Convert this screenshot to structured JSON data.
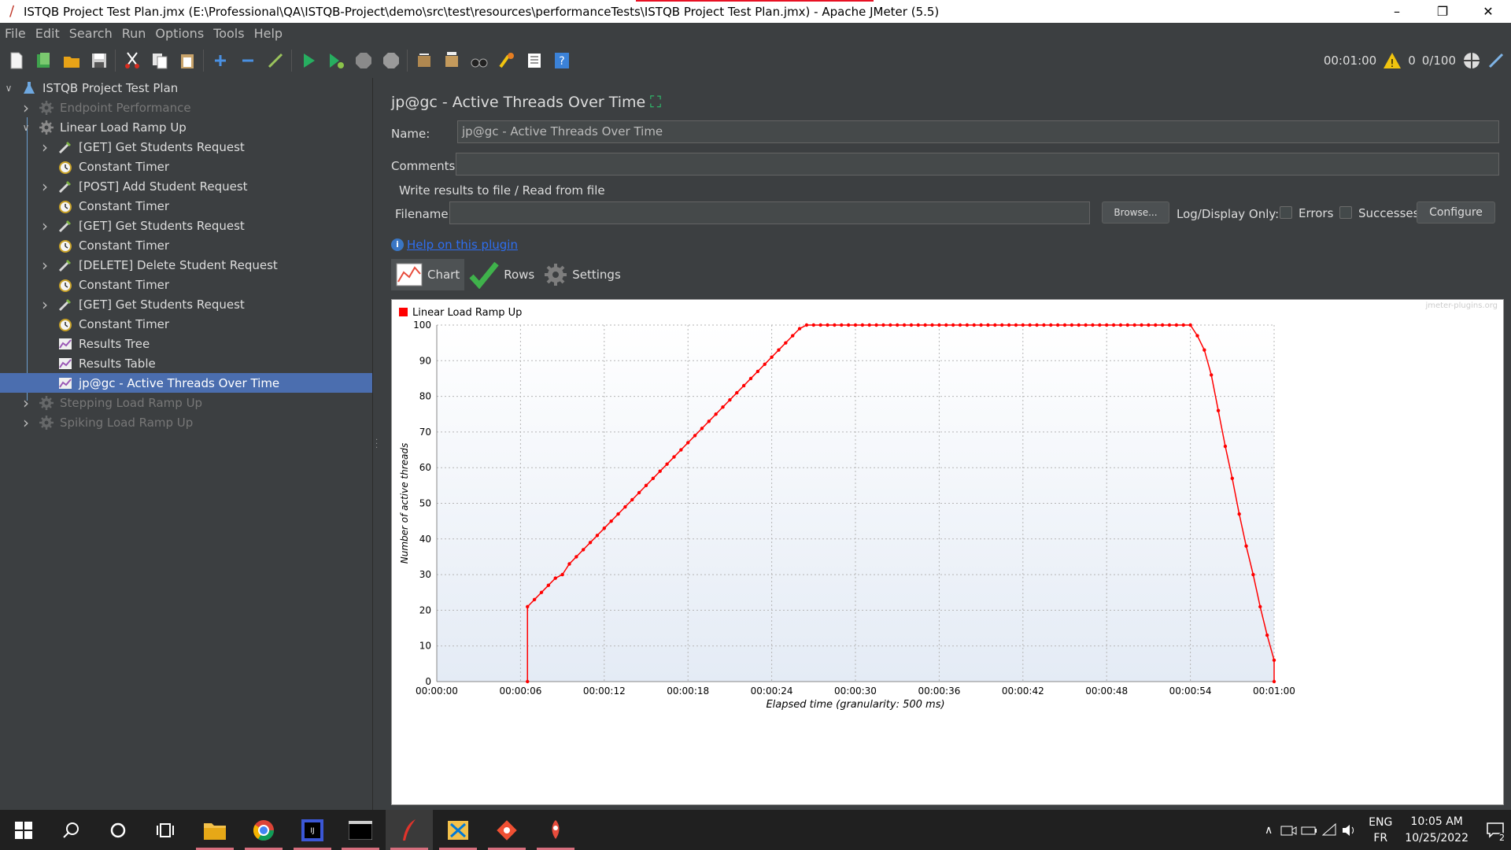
{
  "window": {
    "title": "ISTQB Project Test Plan.jmx (E:\\Professional\\QA\\ISTQB-Project\\demo\\src\\test\\resources\\performanceTests\\ISTQB Project Test Plan.jmx) - Apache JMeter (5.5)",
    "minimize": "–",
    "maximize": "❐",
    "close": "✕"
  },
  "menu": [
    "File",
    "Edit",
    "Search",
    "Run",
    "Options",
    "Tools",
    "Help"
  ],
  "toolbar": {
    "elapsed": "00:01:00",
    "warnings": "0",
    "threads": "0/100"
  },
  "tree": {
    "root": "ISTQB Project Test Plan",
    "items": [
      {
        "label": "Endpoint Performance",
        "icon": "gear-icon",
        "disabled": true
      },
      {
        "label": "Linear Load Ramp Up",
        "icon": "gear-icon",
        "disabled": false
      },
      {
        "label": "[GET] Get Students Request",
        "icon": "pipette-icon",
        "disabled": false
      },
      {
        "label": "Constant Timer",
        "icon": "timer-icon",
        "disabled": false
      },
      {
        "label": "[POST] Add Student Request",
        "icon": "pipette-icon",
        "disabled": false
      },
      {
        "label": "Constant Timer",
        "icon": "timer-icon",
        "disabled": false
      },
      {
        "label": "[GET] Get Students Request",
        "icon": "pipette-icon",
        "disabled": false
      },
      {
        "label": "Constant Timer",
        "icon": "timer-icon",
        "disabled": false
      },
      {
        "label": "[DELETE] Delete Student Request",
        "icon": "pipette-icon",
        "disabled": false
      },
      {
        "label": "Constant Timer",
        "icon": "timer-icon",
        "disabled": false
      },
      {
        "label": "[GET] Get Students Request",
        "icon": "pipette-icon",
        "disabled": false
      },
      {
        "label": "Constant Timer",
        "icon": "timer-icon",
        "disabled": false
      },
      {
        "label": "Results Tree",
        "icon": "listener-icon",
        "disabled": false
      },
      {
        "label": "Results Table",
        "icon": "listener-icon",
        "disabled": false
      },
      {
        "label": "jp@gc - Active Threads Over Time",
        "icon": "listener-icon",
        "disabled": false
      },
      {
        "label": "Stepping Load Ramp Up",
        "icon": "gear-icon",
        "disabled": true
      },
      {
        "label": "Spiking Load Ramp Up",
        "icon": "gear-icon",
        "disabled": true
      }
    ]
  },
  "panel": {
    "title": "jp@gc - Active Threads Over Time",
    "name_label": "Name:",
    "name_value": "jp@gc - Active Threads Over Time",
    "comments_label": "Comments:",
    "comments_value": "",
    "file_section": "Write results to file / Read from file",
    "filename_label": "Filename",
    "filename_value": "",
    "browse": "Browse...",
    "log_display": "Log/Display Only:",
    "errors": "Errors",
    "successes": "Successes",
    "configure": "Configure",
    "help_link": "Help on this plugin",
    "tabs": [
      "Chart",
      "Rows",
      "Settings"
    ]
  },
  "chart_data": {
    "type": "line",
    "watermark": "jmeter-plugins.org",
    "xlabel": "Elapsed time (granularity: 500 ms)",
    "ylabel": "Number of active threads",
    "xticks": [
      "00:00:00",
      "00:00:06",
      "00:00:12",
      "00:00:18",
      "00:00:24",
      "00:00:30",
      "00:00:36",
      "00:00:42",
      "00:00:48",
      "00:00:54",
      "00:01:00"
    ],
    "yticks": [
      0,
      10,
      20,
      30,
      40,
      50,
      60,
      70,
      80,
      90,
      100
    ],
    "xlim": [
      0,
      60
    ],
    "ylim": [
      0,
      100
    ],
    "grid": true,
    "legend_position": "top-left",
    "series": [
      {
        "name": "Linear Load Ramp Up",
        "color": "#ff0000",
        "x": [
          6.5,
          6.5,
          7.0,
          7.5,
          8.0,
          8.5,
          9.0,
          9.5,
          10.0,
          10.5,
          11.0,
          11.5,
          12.0,
          12.5,
          13.0,
          13.5,
          14.0,
          14.5,
          15.0,
          15.5,
          16.0,
          16.5,
          17.0,
          17.5,
          18.0,
          18.5,
          19.0,
          19.5,
          20.0,
          20.5,
          21.0,
          21.5,
          22.0,
          22.5,
          23.0,
          23.5,
          24.0,
          24.5,
          25.0,
          25.5,
          26.0,
          26.5,
          27.0,
          27.5,
          28.0,
          28.5,
          29.0,
          29.5,
          30.0,
          30.5,
          31,
          31.5,
          32,
          32.5,
          33,
          33.5,
          34,
          34.5,
          35,
          35.5,
          36,
          36.5,
          37,
          37.5,
          38,
          38.5,
          39,
          39.5,
          40,
          40.5,
          41,
          41.5,
          42,
          42.5,
          43,
          43.5,
          44,
          44.5,
          45,
          45.5,
          46,
          46.5,
          47,
          47.5,
          48,
          48.5,
          49,
          49.5,
          50,
          50.5,
          51,
          51.5,
          52,
          52.5,
          53,
          53.5,
          54.0,
          54.5,
          55.0,
          55.5,
          56.0,
          56.5,
          57.0,
          57.5,
          58.0,
          58.5,
          59.0,
          59.5,
          60.0,
          60.0
        ],
        "y": [
          0,
          21,
          23,
          25,
          27,
          29,
          30,
          33,
          35,
          37,
          39,
          41,
          43,
          45,
          47,
          49,
          51,
          53,
          55,
          57,
          59,
          61,
          63,
          65,
          67,
          69,
          71,
          73,
          75,
          77,
          79,
          81,
          83,
          85,
          87,
          89,
          91,
          93,
          95,
          97,
          99,
          100,
          100,
          100,
          100,
          100,
          100,
          100,
          100,
          100,
          100,
          100,
          100,
          100,
          100,
          100,
          100,
          100,
          100,
          100,
          100,
          100,
          100,
          100,
          100,
          100,
          100,
          100,
          100,
          100,
          100,
          100,
          100,
          100,
          100,
          100,
          100,
          100,
          100,
          100,
          100,
          100,
          100,
          100,
          100,
          100,
          100,
          100,
          100,
          100,
          100,
          100,
          100,
          100,
          100,
          100,
          100,
          97,
          93,
          86,
          76,
          66,
          57,
          47,
          38,
          30,
          21,
          13,
          6,
          0
        ]
      }
    ]
  },
  "taskbar": {
    "lang_top": "ENG",
    "lang_bottom": "FR",
    "time": "10:05 AM",
    "date": "10/25/2022",
    "notif_count": "2"
  }
}
